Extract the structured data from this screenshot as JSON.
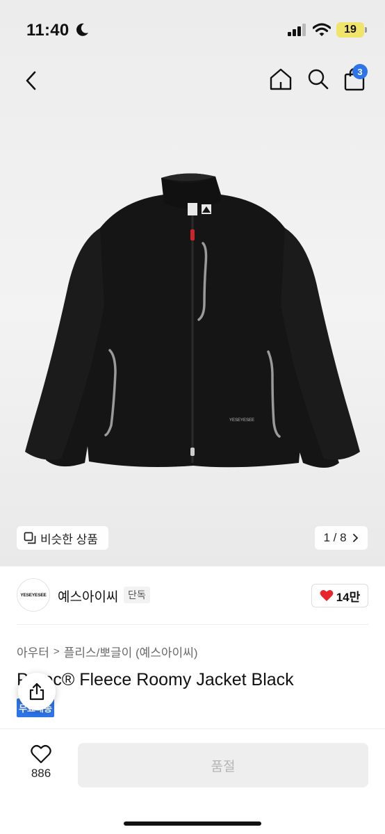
{
  "status_bar": {
    "time": "11:40",
    "battery": "19"
  },
  "nav": {
    "cart_count": "3"
  },
  "gallery": {
    "similar_label": "비슷한 상품",
    "pager": "1 / 8"
  },
  "product_image": {
    "chest_logo": "YESEYESEE"
  },
  "shop": {
    "logo_text": "YESEYESEE",
    "name": "예스아이씨",
    "exclusive_badge": "단독",
    "likes": "14만"
  },
  "breadcrumb": {
    "level1": "아우터",
    "level2": "플리스/뽀글이 (예스아이씨)"
  },
  "product": {
    "title": "P    rtec® Fleece Roomy Jacket Black",
    "badge": "무료배송"
  },
  "bottom_bar": {
    "wish_count": "886",
    "purchase_button": "품절"
  },
  "colors": {
    "accent": "#2d74e8",
    "like_heart": "#e8242c",
    "jacket": "#151515",
    "zipper_pull": "#c8262b"
  },
  "icons": [
    "moon-icon",
    "signal-icon",
    "wifi-icon",
    "back-icon",
    "home-icon",
    "search-icon",
    "shopping-bag-icon",
    "similar-icon",
    "chevron-right-icon",
    "heart-filled-icon",
    "share-icon",
    "heart-outline-icon"
  ]
}
